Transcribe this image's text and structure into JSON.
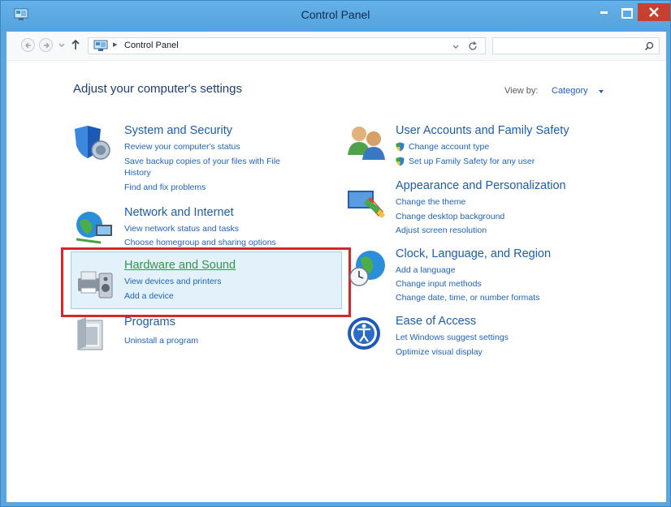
{
  "window": {
    "title": "Control Panel",
    "colors": {
      "frame": "#5aa6df",
      "close": "#c7402f",
      "link": "#1f63bf",
      "title_link": "#1d5ea5",
      "highlight_border": "#d6262d"
    }
  },
  "address_bar": {
    "separator": "▸",
    "path": "Control Panel",
    "search_placeholder": ""
  },
  "main": {
    "heading": "Adjust your computer's settings",
    "view_by_label": "View by:",
    "view_by_value": "Category"
  },
  "categories": [
    {
      "title": "System and Security",
      "icon": "shield-icon",
      "links": [
        "Review your computer's status",
        "Save backup copies of your files with File",
        "History",
        "Find and fix problems"
      ]
    },
    {
      "title": "Network and Internet",
      "icon": "network-globe-icon",
      "links": [
        "View network status and tasks",
        "Choose homegroup and sharing options"
      ]
    },
    {
      "title": "Hardware and Sound",
      "icon": "printer-speaker-icon",
      "links": [
        "View devices and printers",
        "Add a device"
      ]
    },
    {
      "title": "Programs",
      "icon": "programs-icon",
      "links": [
        "Uninstall a program"
      ]
    },
    {
      "title": "User Accounts and Family Safety",
      "icon": "users-icon",
      "links": [
        "Change account type",
        "Set up Family Safety for any user"
      ]
    },
    {
      "title": "Appearance and Personalization",
      "icon": "appearance-icon",
      "links": [
        "Change the theme",
        "Change desktop background",
        "Adjust screen resolution"
      ]
    },
    {
      "title": "Clock, Language, and Region",
      "icon": "clock-globe-icon",
      "links": [
        "Add a language",
        "Change input methods",
        "Change date, time, or number formats"
      ]
    },
    {
      "title": "Ease of Access",
      "icon": "ease-of-access-icon",
      "links": [
        "Let Windows suggest settings",
        "Optimize visual display"
      ]
    }
  ]
}
